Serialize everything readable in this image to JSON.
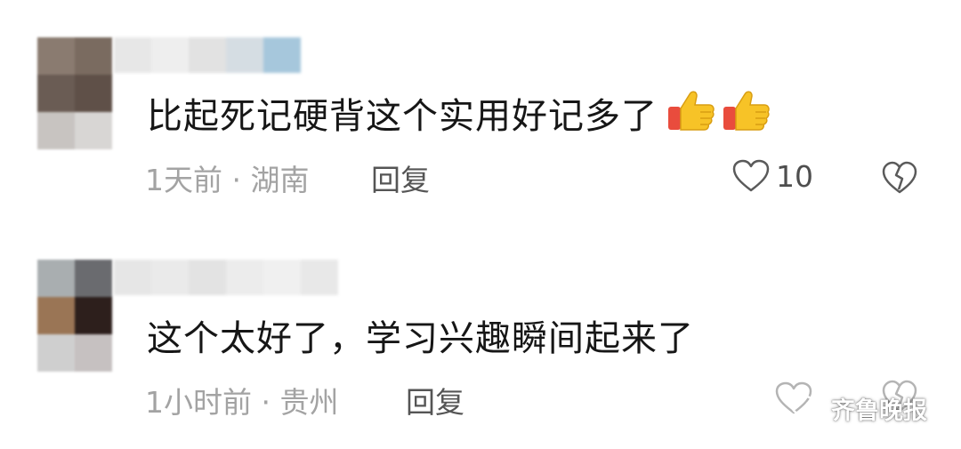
{
  "comments": [
    {
      "text": "比起死记硬背这个实用好记多了",
      "emoji": "thumbs-up",
      "meta": "1天前 · 湖南",
      "reply_label": "回复",
      "like_count": "10",
      "avatar_colors": [
        "#8a7b70",
        "#7a6b60",
        "#6a5c54",
        "#5f5048",
        "#c8c4c1",
        "#d8d6d4"
      ],
      "username_colors": [
        "#e7e7e7",
        "#eeeeee",
        "#e2e2e2",
        "#d5dde3",
        "#a6c7dc"
      ]
    },
    {
      "text": "这个太好了，学习兴趣瞬间起来了",
      "meta": "1小时前 · 贵州",
      "reply_label": "回复",
      "avatar_colors": [
        "#a9aeb0",
        "#6a6b6f",
        "#9a7555",
        "#2d1f1c",
        "#cfcfcf",
        "#c6c1c1"
      ],
      "username_colors": [
        "#e6e6e6",
        "#eaeaea",
        "#e3e3e3",
        "#ececec",
        "#f0f0f0",
        "#e8e8e8"
      ]
    }
  ],
  "watermark": {
    "text": "齐鲁晚报",
    "icon": "wechat-icon"
  },
  "colors": {
    "text": "#161616",
    "meta": "#a3a3a3",
    "reply": "#555555",
    "icon": "#5a5a5a",
    "emoji_yellow": "#f7c327",
    "emoji_red": "#e94c3d"
  }
}
